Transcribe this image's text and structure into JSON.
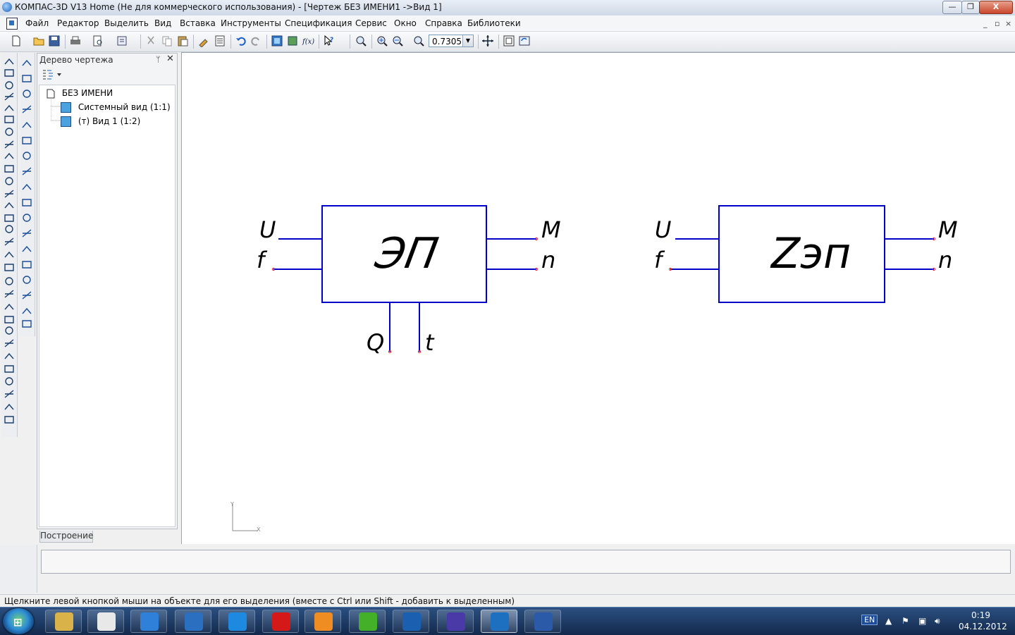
{
  "window": {
    "title": "КОМПАС-3D V13 Home (Не для коммерческого использования) - [Чертеж БЕЗ ИМЕНИ1 ->Вид 1]",
    "minimize": "—",
    "maximize": "❐",
    "close": "X"
  },
  "menu": {
    "items": [
      "Файл",
      "Редактор",
      "Выделить",
      "Вид",
      "Вставка",
      "Инструменты",
      "Спецификация",
      "Сервис",
      "Окно",
      "Справка",
      "Библиотеки"
    ],
    "mdi_minimize": "_",
    "mdi_restore": "▫",
    "mdi_close": "×"
  },
  "toolbar": {
    "zoom_value": "0.7305"
  },
  "tree": {
    "title": "Дерево чертежа",
    "pin": "ᛘ",
    "close": "✕",
    "root": "БЕЗ ИМЕНИ",
    "items": [
      "Системный вид (1:1)",
      "(т) Вид 1 (1:2)"
    ],
    "tab": "Построение"
  },
  "drawing": {
    "block1": {
      "label": "ЭП",
      "in1": "U",
      "in2": "f",
      "out1": "M",
      "out2": "n",
      "bot1": "Q",
      "bot2": "t"
    },
    "block2": {
      "label": "Zэп",
      "in1": "U",
      "in2": "f",
      "out1": "M",
      "out2": "n"
    },
    "axis_y": "Y",
    "axis_x": "X",
    "colors": {
      "lines": "#0000c8",
      "text": "#000000",
      "points": "#e8223a"
    }
  },
  "status": {
    "text": "Щелкните левой кнопкой мыши на объекте для его выделения (вместе с Ctrl или Shift - добавить к выделенным)"
  },
  "taskbar": {
    "lang": "EN",
    "time": "0:19",
    "date": "04.12.2012",
    "apps": [
      "explorer-icon",
      "yandex-browser-icon",
      "mail-icon",
      "download-icon",
      "internet-explorer-icon",
      "yandex-icon",
      "media-player-icon",
      "icq-icon",
      "mail-agent-icon",
      "kompas-pen-icon",
      "kompas-icon",
      "word-icon"
    ]
  }
}
